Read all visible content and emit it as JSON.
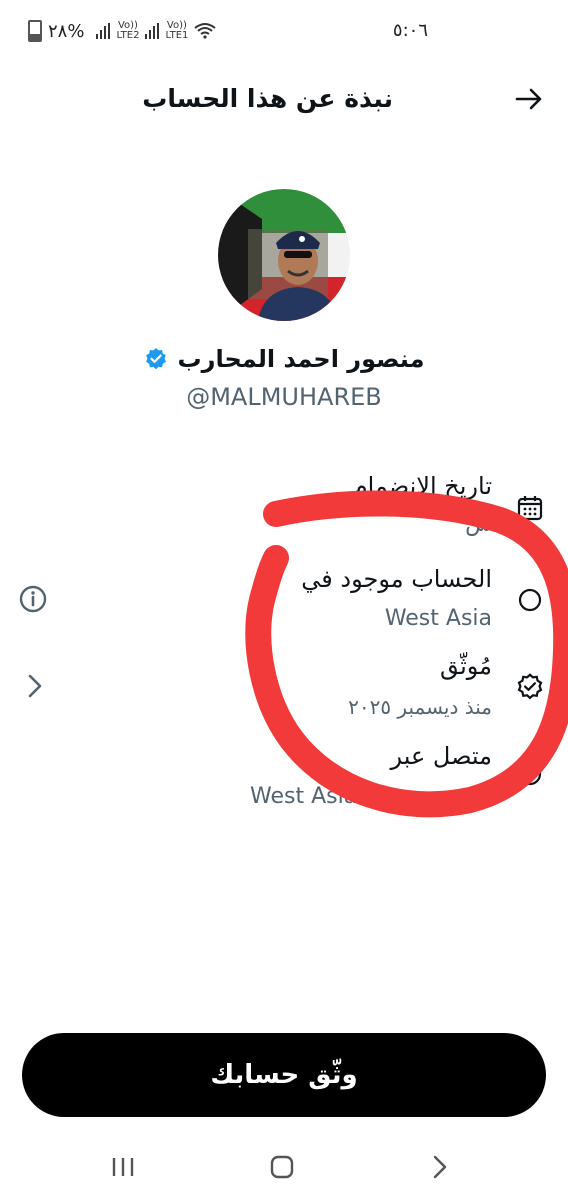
{
  "status_bar": {
    "time": "٥:٠٦",
    "battery": "٢٨%",
    "sim1": "LTE1",
    "sim2": "LTE2",
    "volte": "Vo))"
  },
  "header": {
    "title": "نبذة عن هذا الحساب"
  },
  "profile": {
    "display_name": "منصور احمد المحارب",
    "handle": "@MALMUHAREB"
  },
  "rows": [
    {
      "label": "تاريخ الانضمام",
      "value": "س",
      "icon": "calendar-icon"
    },
    {
      "label": "الحساب موجود في",
      "value": "West Asia",
      "icon": "location-icon"
    },
    {
      "label": "مُوثّق",
      "value": "منذ ديسمبر ٢٠٢٥",
      "icon": "verified-badge-icon"
    },
    {
      "label": "متصل عبر",
      "value": "West Asia Ap",
      "icon": "connection-icon"
    }
  ],
  "button": {
    "label": "وثّق حسابك"
  },
  "colors": {
    "verified_blue": "#1d9bf0",
    "annotation_red": "#f23a3a",
    "button_bg": "#000000",
    "muted_text": "#536471"
  }
}
